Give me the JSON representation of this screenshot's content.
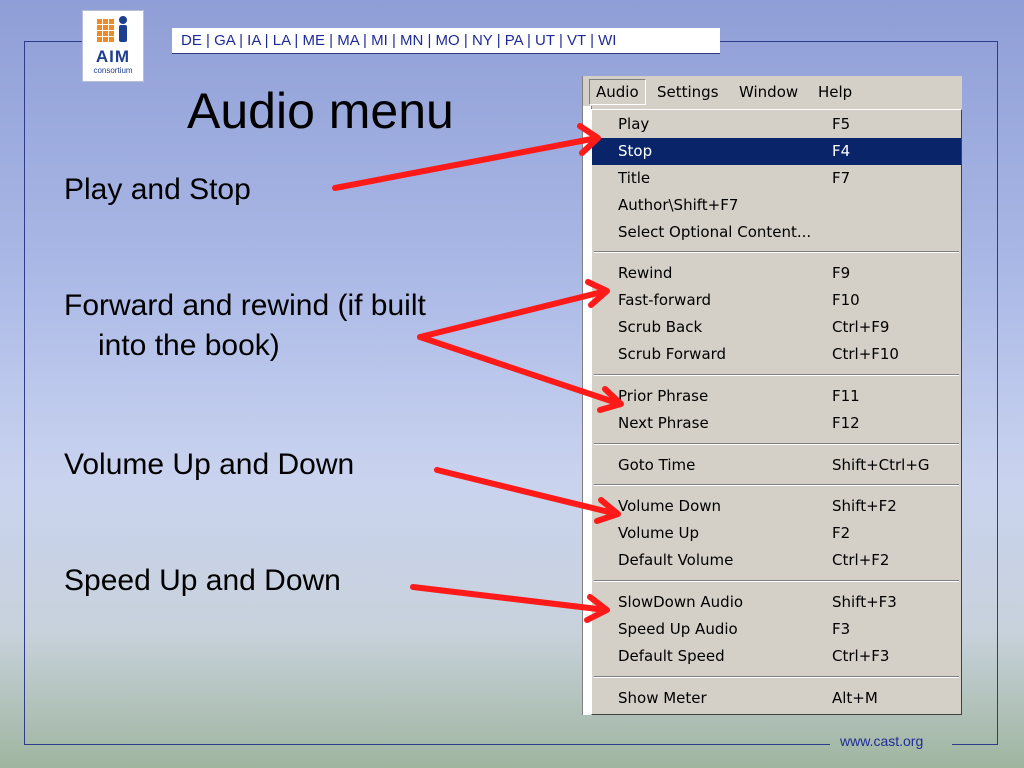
{
  "slide": {
    "title": "Audio menu",
    "states_bar": "DE | GA | IA | LA | ME | MA | MI | MN | MO | NY | PA | UT | VT | WI",
    "logo": {
      "text": "AIM",
      "subtext": "consortium"
    },
    "footer": "www.cast.org",
    "bullets": [
      {
        "line1": "Play and Stop"
      },
      {
        "line1": "Forward and rewind (if built",
        "line2": "into the book)"
      },
      {
        "line1": "Volume Up and Down"
      },
      {
        "line1": "Speed Up and Down"
      }
    ],
    "colors": {
      "arrow": "#ff1a1a",
      "frame": "#2f3c8c",
      "highlight": "#0a246a"
    }
  },
  "menubar": [
    "Audio",
    "Settings",
    "Window",
    "Help"
  ],
  "audio_menu": {
    "items": [
      {
        "label": "Play",
        "key": "F5"
      },
      {
        "label": "Stop",
        "key": "F4",
        "highlighted": true
      },
      {
        "label": "Title",
        "key": "F7"
      },
      {
        "label": "Author\\Shift+F7",
        "key": ""
      },
      {
        "label": "Select Optional Content...",
        "key": ""
      },
      {
        "label": "Rewind",
        "key": "F9"
      },
      {
        "label": "Fast-forward",
        "key": "F10"
      },
      {
        "label": "Scrub Back",
        "key": "Ctrl+F9"
      },
      {
        "label": "Scrub Forward",
        "key": "Ctrl+F10"
      },
      {
        "label": "Prior Phrase",
        "key": "F11"
      },
      {
        "label": "Next Phrase",
        "key": "F12"
      },
      {
        "label": "Goto Time",
        "key": "Shift+Ctrl+G"
      },
      {
        "label": "Volume Down",
        "key": "Shift+F2"
      },
      {
        "label": "Volume Up",
        "key": "F2"
      },
      {
        "label": "Default Volume",
        "key": "Ctrl+F2"
      },
      {
        "label": "SlowDown Audio",
        "key": "Shift+F3"
      },
      {
        "label": "Speed Up Audio",
        "key": "F3"
      },
      {
        "label": "Default Speed",
        "key": "Ctrl+F3"
      },
      {
        "label": "Show Meter",
        "key": "Alt+M"
      }
    ]
  }
}
